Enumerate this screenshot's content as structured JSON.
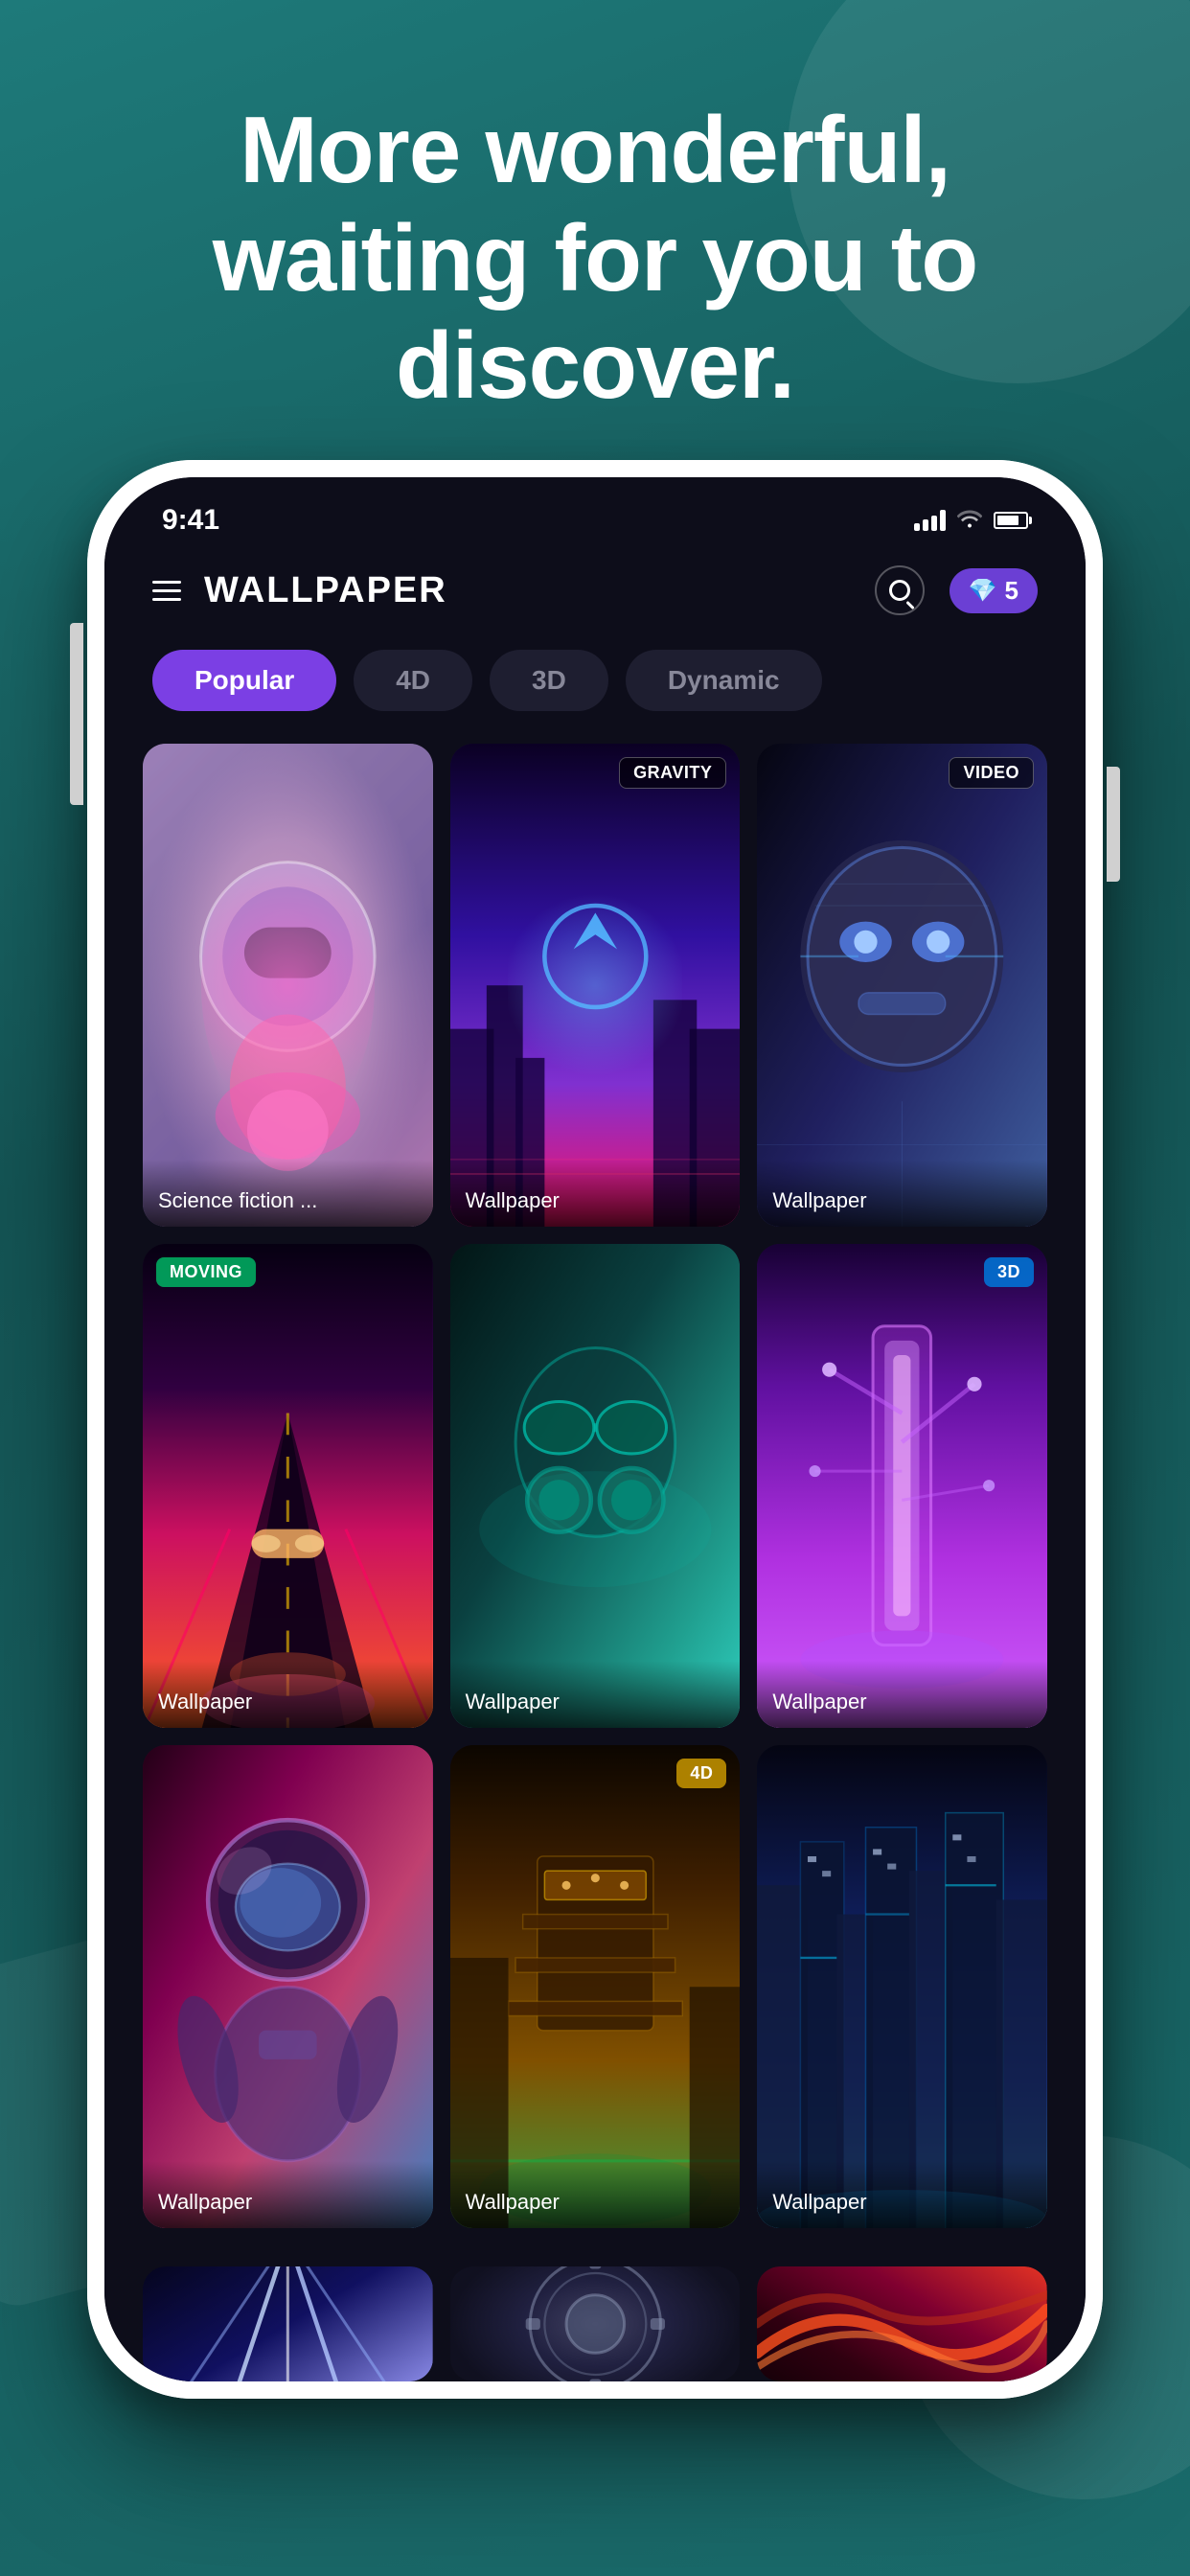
{
  "app": {
    "background_color": "#1a6b6b",
    "headline": "More wonderful, waiting for you to discover."
  },
  "status_bar": {
    "time": "9:41",
    "signal_label": "signal bars",
    "wifi_label": "wifi",
    "battery_label": "battery"
  },
  "header": {
    "title": "WALLPAPER",
    "menu_label": "menu",
    "search_label": "search",
    "gems_count": "5",
    "gems_icon": "💎"
  },
  "tabs": [
    {
      "label": "Popular",
      "active": true
    },
    {
      "label": "4D",
      "active": false
    },
    {
      "label": "3D",
      "active": false
    },
    {
      "label": "Dynamic",
      "active": false
    }
  ],
  "wallpapers": [
    {
      "id": 1,
      "label": "Science fiction ...",
      "badge": null,
      "theme": "scifi"
    },
    {
      "id": 2,
      "label": "Wallpaper",
      "badge": "GRAVITY",
      "badge_type": "gravity",
      "theme": "gravity"
    },
    {
      "id": 3,
      "label": "Wallpaper",
      "badge": "VIDEO",
      "badge_type": "video",
      "theme": "robot-face"
    },
    {
      "id": 4,
      "label": "Wallpaper",
      "badge": "MOVING",
      "badge_type": "moving",
      "theme": "moving-road"
    },
    {
      "id": 5,
      "label": "Wallpaper",
      "badge": null,
      "theme": "mask"
    },
    {
      "id": 6,
      "label": "Wallpaper",
      "badge": "3D",
      "badge_type": "3d",
      "theme": "purple-nature"
    },
    {
      "id": 7,
      "label": "Wallpaper",
      "badge": null,
      "theme": "astronaut"
    },
    {
      "id": 8,
      "label": "Wallpaper",
      "badge": "4D",
      "badge_type": "4d",
      "theme": "4d-city"
    },
    {
      "id": 9,
      "label": "Wallpaper",
      "badge": null,
      "theme": "cyber-city"
    },
    {
      "id": 10,
      "label": "",
      "badge": null,
      "theme": "laser"
    },
    {
      "id": 11,
      "label": "",
      "badge": null,
      "theme": "mech"
    },
    {
      "id": 12,
      "label": "",
      "badge": null,
      "theme": "abstract"
    }
  ]
}
